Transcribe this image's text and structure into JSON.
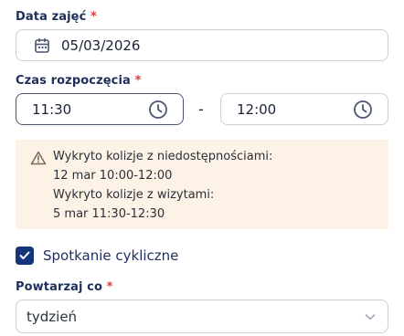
{
  "date_section": {
    "label": "Data zajęć",
    "required_mark": "*",
    "value": "05/03/2026",
    "icon": "calendar-icon"
  },
  "time_section": {
    "label": "Czas rozpoczęcia",
    "required_mark": "*",
    "start_value": "11:30",
    "end_value": "12:00",
    "separator": "-",
    "icon": "clock-icon"
  },
  "warning": {
    "icon": "warning-triangle-icon",
    "lines": [
      "Wykryto kolizje z niedostępnościami:",
      "12 mar 10:00-12:00",
      "Wykryto kolizje z wizytami:",
      "5 mar 11:30-12:30"
    ],
    "background": "#fdf2e6"
  },
  "recurring": {
    "label": "Spotkanie cykliczne",
    "checked": true,
    "color": "#15357a"
  },
  "repeat_section": {
    "label": "Powtarzaj co",
    "required_mark": "*",
    "selected": "tydzień",
    "icon": "chevron-down-icon"
  }
}
